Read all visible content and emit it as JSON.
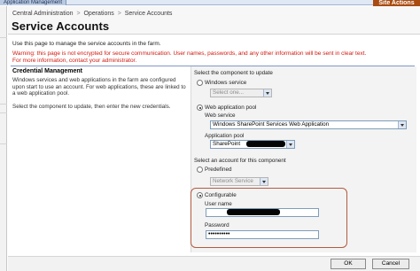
{
  "window": {
    "app_tab": "Application Management",
    "site_actions": "Site Actions"
  },
  "breadcrumb": [
    "Central Administration",
    "Operations",
    "Service Accounts"
  ],
  "breadcrumb_sep": ">",
  "page": {
    "title": "Service Accounts",
    "intro": "Use this page to manage the service accounts in the farm.",
    "warning_line1": "Warning: this page is not encrypted for secure communication. User names, passwords, and any other information will be sent in clear text.",
    "warning_line2": "For more information, contact your administrator."
  },
  "credential_section": {
    "title": "Credential Management",
    "description": "Windows services and web applications in the farm are configured upon start to use an account. For web applications, these are linked to a web application pool.",
    "instruction": "Select the component to update, then enter the new credentials."
  },
  "component": {
    "heading": "Select the component to update",
    "windows_service_label": "Windows service",
    "windows_service_value": "Select one...",
    "web_app_pool_label": "Web application pool",
    "web_service_label": "Web service",
    "web_service_value": "Windows SharePoint Services Web Application",
    "app_pool_label": "Application pool",
    "app_pool_value": "SharePoint"
  },
  "account": {
    "heading": "Select an account for this component",
    "predefined_label": "Predefined",
    "predefined_value": "Network Service",
    "configurable_label": "Configurable",
    "username_label": "User name",
    "password_label": "Password",
    "password_value": "••••••••••"
  },
  "buttons": {
    "ok": "OK",
    "cancel": "Cancel"
  },
  "colors": {
    "warning": "#d0180e",
    "site_actions": "#a94c12",
    "divider": "#7f99c7",
    "highlight": "#b35a40"
  }
}
